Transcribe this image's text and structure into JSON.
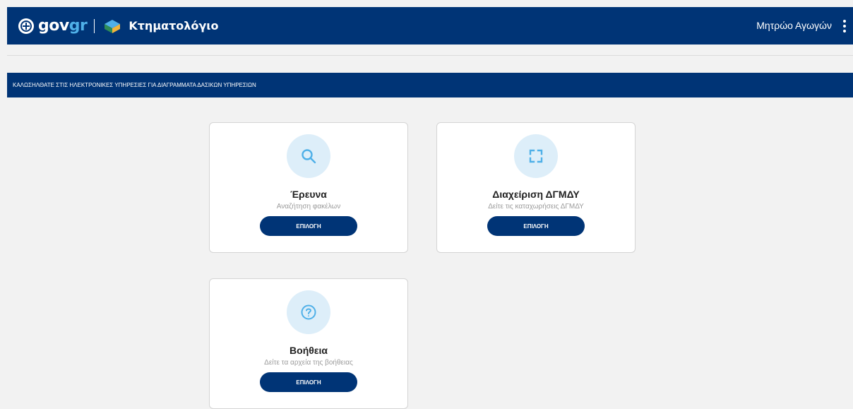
{
  "header": {
    "logo_text_gov": "gov",
    "logo_text_gr": "gr",
    "app_title": "Κτηματολόγιο",
    "user_name": "Μητρώο Αγωγών"
  },
  "welcome_text": "ΚΑΛΩΣΗΛΘΑΤΕ ΣΤΙΣ ΗΛΕΚΤΡΟΝΙΚΕΣ ΥΠΗΡΕΣΙΕΣ ΓΙΑ ΔΙΑΓΡΑΜΜΑΤΑ ΔΑΣΙΚΩΝ ΥΠΗΡΕΣΙΩΝ",
  "cards": [
    {
      "icon": "search-icon",
      "title": "Έρευνα",
      "subtitle": "Αναζήτηση φακέλων",
      "button": "ΕΠΙΛΟΓΗ"
    },
    {
      "icon": "expand-icon",
      "title": "Διαχείριση ΔΓΜΔΥ",
      "subtitle": "Δείτε τις καταχωρήσεις ΔΓΜΔΥ",
      "button": "ΕΠΙΛΟΓΗ"
    },
    {
      "icon": "help-icon",
      "title": "Βοήθεια",
      "subtitle": "Δείτε τα αρχεία της βοήθειας",
      "button": "ΕΠΙΛΟΓΗ"
    }
  ],
  "colors": {
    "primary": "#003476",
    "accent": "#4fb0e8",
    "icon_bg": "#ddeef9"
  }
}
